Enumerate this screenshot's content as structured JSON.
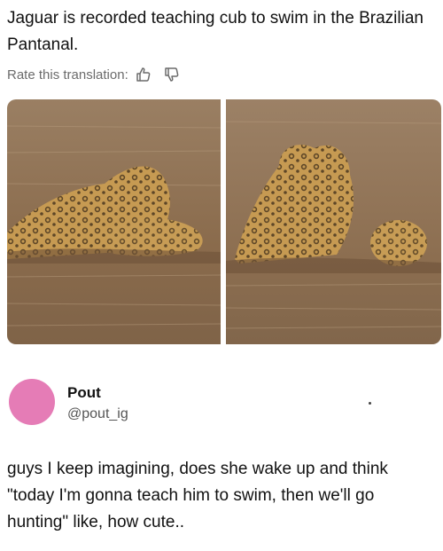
{
  "post": {
    "text": "Jaguar is recorded teaching cub to swim in the Brazilian Pantanal.",
    "rate_label": "Rate this translation:",
    "icons": [
      "thumbs-up-icon",
      "thumbs-down-icon"
    ]
  },
  "photos": {
    "count": 2,
    "colors": {
      "water": "#8a6f55",
      "jaguar": "#c69a52",
      "spots": "#3a2a18"
    }
  },
  "reply": {
    "name": "Pout",
    "handle": "@pout_ig",
    "avatar_color": "#e57cb6",
    "text": "guys I keep imagining, does she wake up and think \"today I'm gonna teach him to swim, then we'll go hunting\" like, how cute.."
  }
}
